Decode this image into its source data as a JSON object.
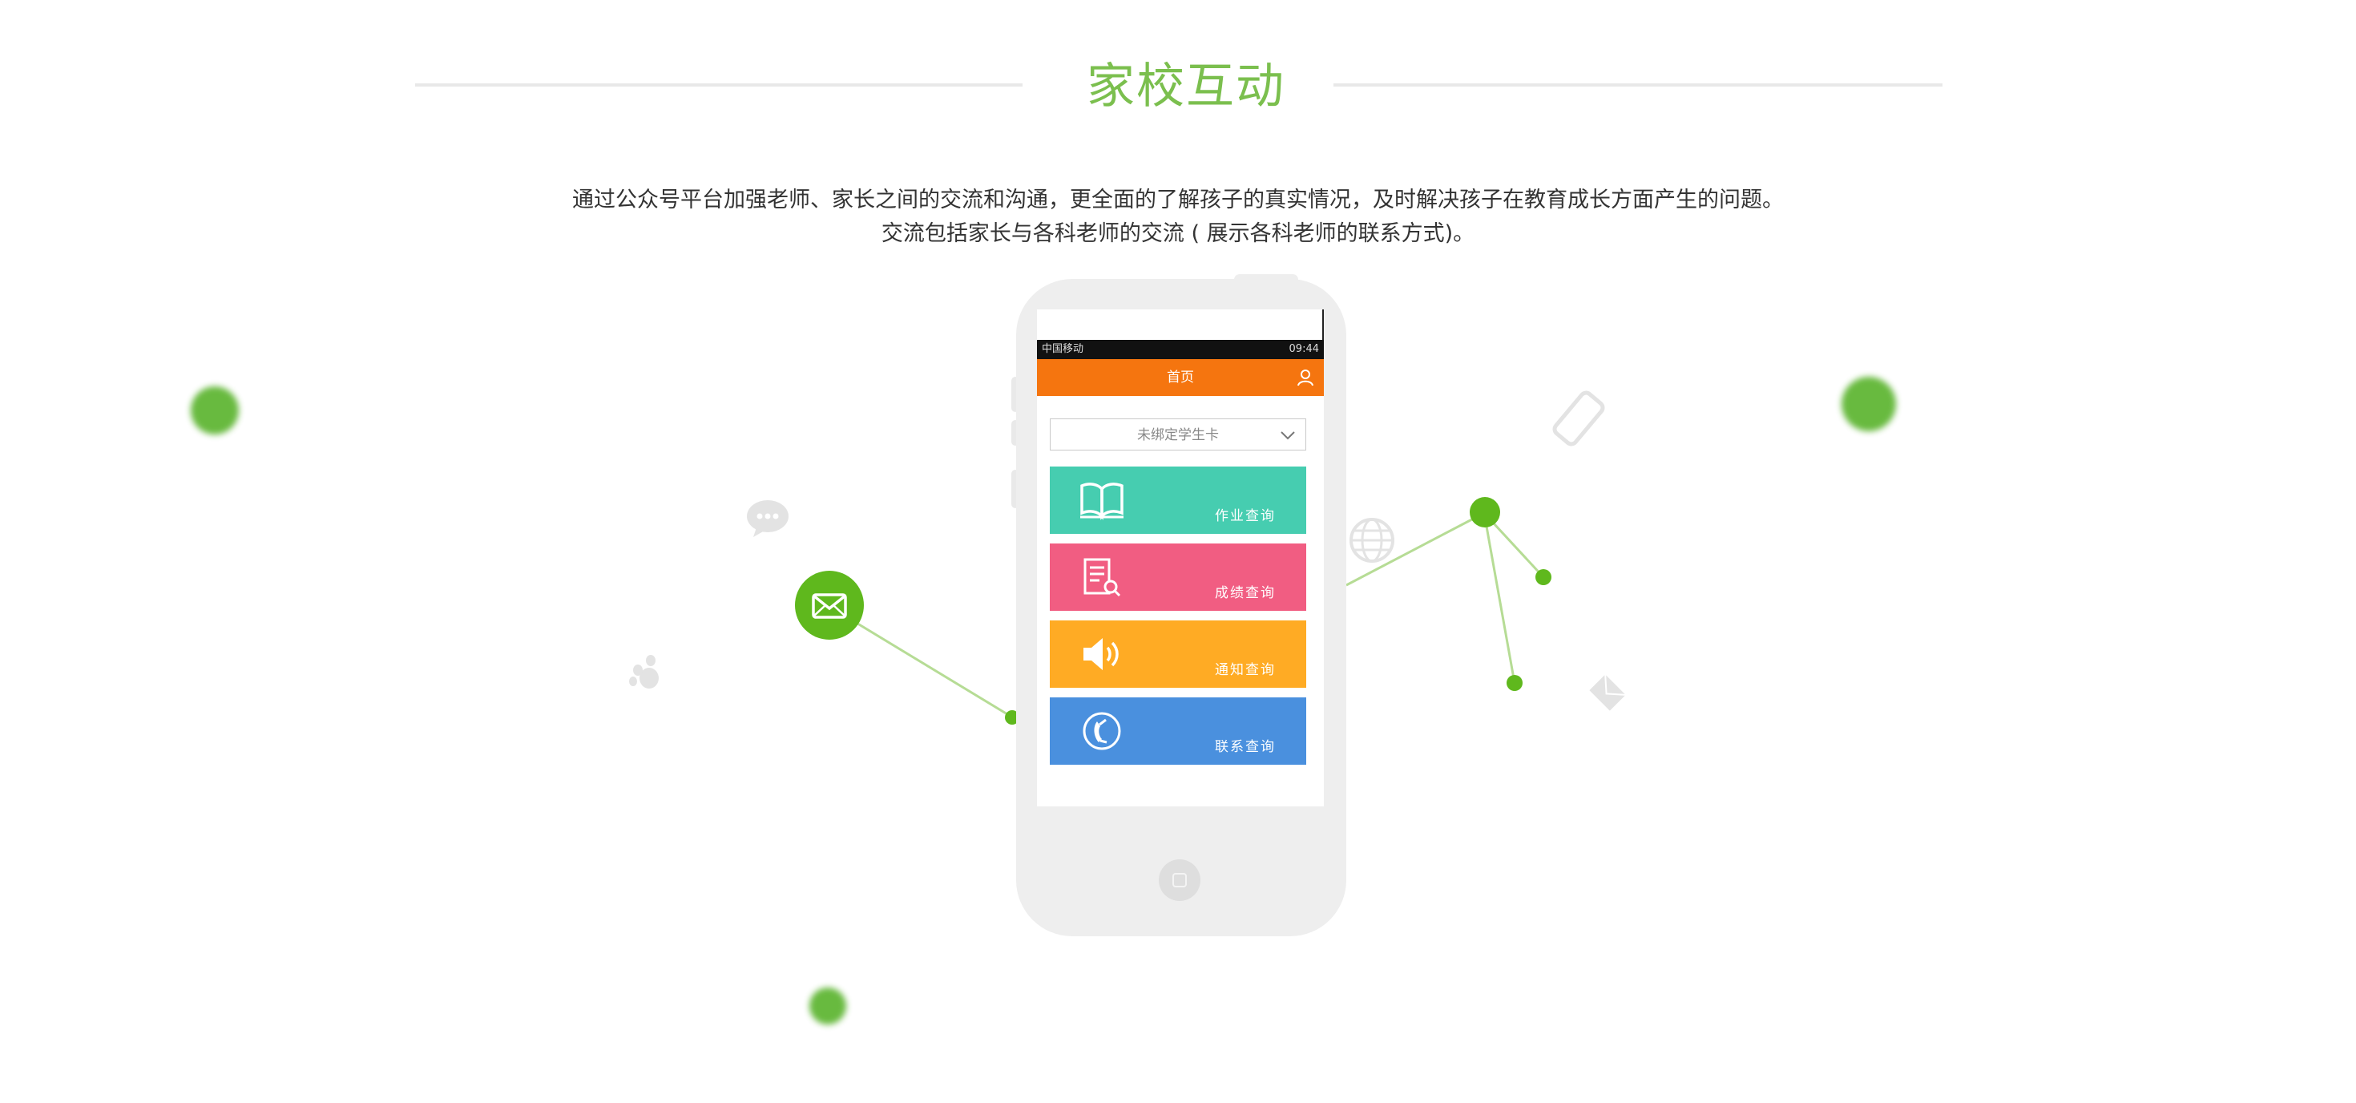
{
  "section": {
    "title": "家校互动",
    "desc_line1": "通过公众号平台加强老师、家长之间的交流和沟通，更全面的了解孩子的真实情况，及时解决孩子在教育成长方面产生的问题。",
    "desc_line2": "交流包括家长与各科老师的交流 ( 展示各科老师的联系方式)。"
  },
  "phone": {
    "status_left": "中国移动",
    "status_time": "09:44",
    "header_title": "首页",
    "select_value": "未绑定学生卡",
    "tiles": [
      {
        "label": "作业查询",
        "icon": "book-icon",
        "color": "#46cdb0"
      },
      {
        "label": "成绩查询",
        "icon": "report-search-icon",
        "color": "#f15d82"
      },
      {
        "label": "通知查询",
        "icon": "speaker-icon",
        "color": "#ffab24"
      },
      {
        "label": "联系查询",
        "icon": "phone-icon",
        "color": "#4a90de"
      }
    ]
  },
  "colors": {
    "accent_green": "#7bbf4e",
    "node_green": "#5fb81d",
    "app_orange": "#f5750f"
  }
}
